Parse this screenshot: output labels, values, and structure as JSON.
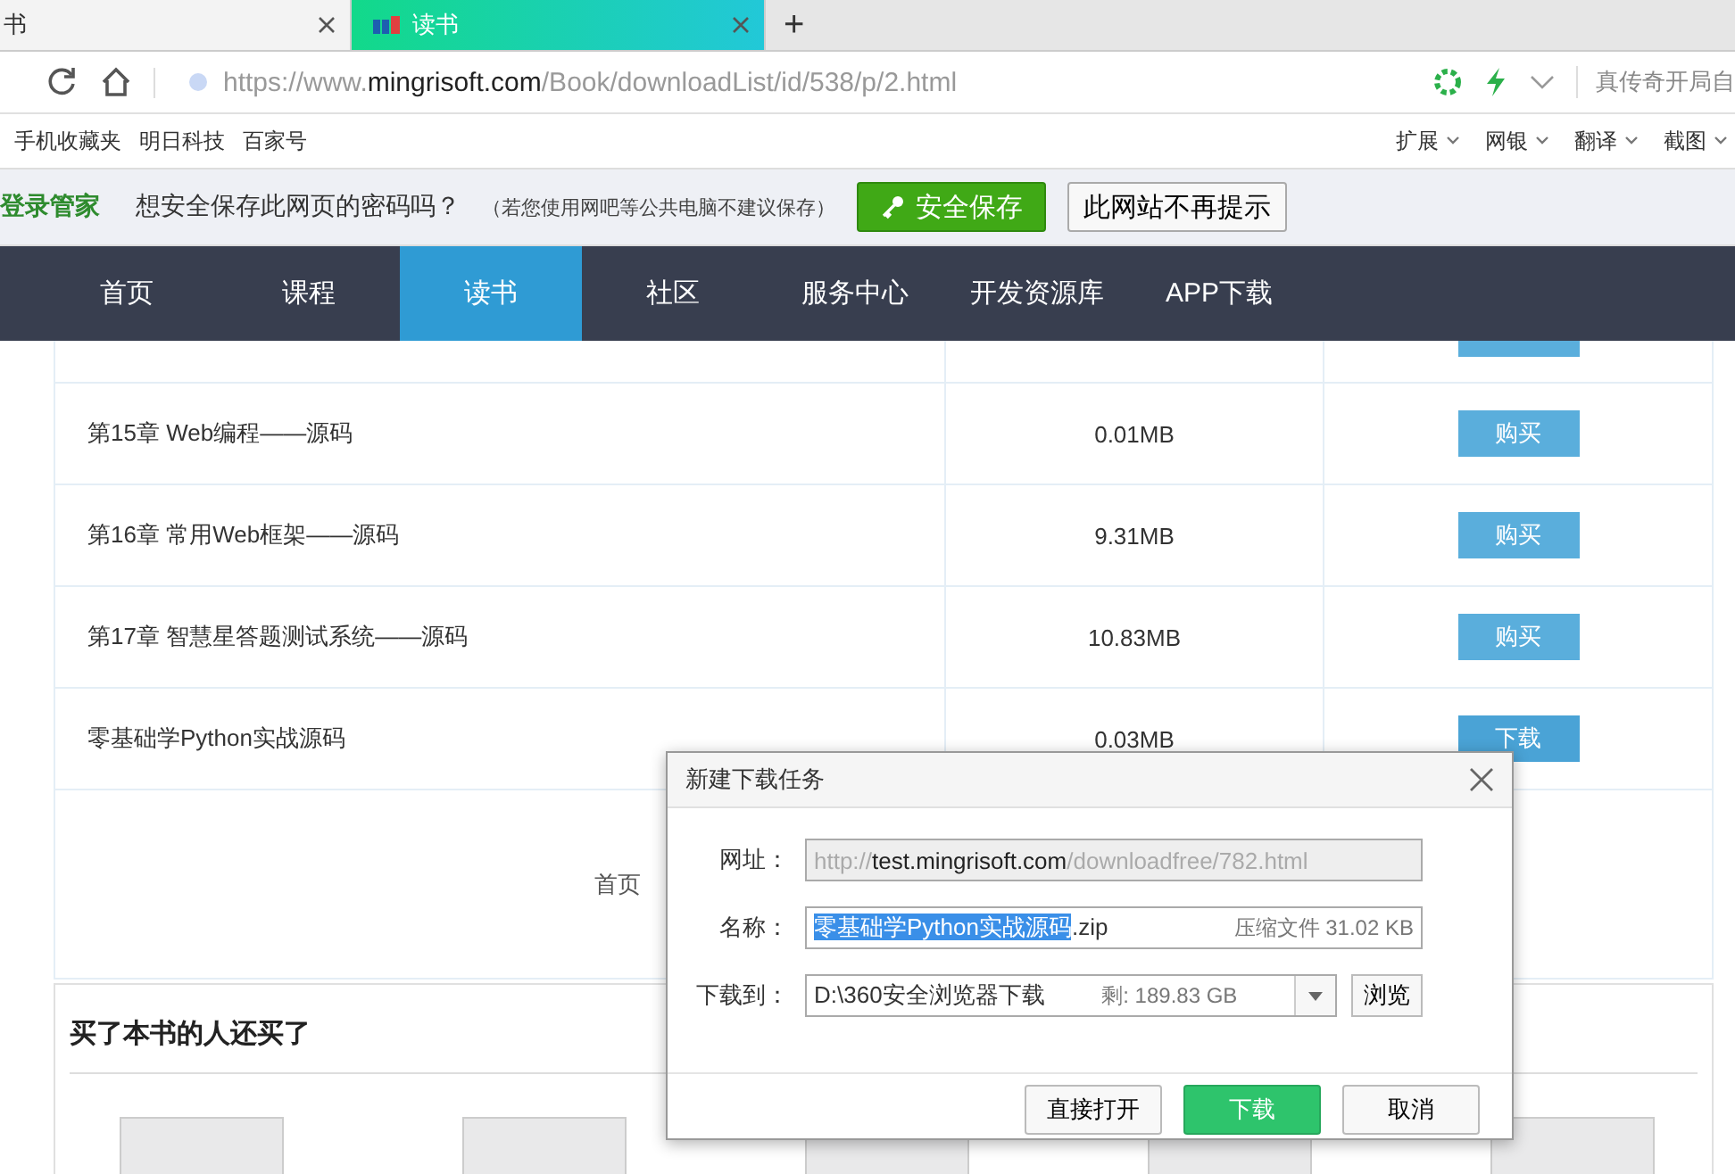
{
  "browser": {
    "tabs": [
      {
        "label": "书",
        "selected": false
      },
      {
        "label": "读书",
        "selected": true
      }
    ],
    "new_tab": "+",
    "address": {
      "scheme": "https://www.",
      "domain": "mingrisoft.com",
      "path": "/Book/downloadList/id/538/p/2.html"
    },
    "search_hint": "真传奇开局自",
    "bookmarks": [
      "手机收藏夹",
      "明日科技",
      "百家号"
    ],
    "tools": [
      "扩展",
      "网银",
      "翻译",
      "截图"
    ],
    "password_bar": {
      "brand": "登录管家",
      "question": "想安全保存此网页的密码吗？",
      "note": "（若您使用网吧等公共电脑不建议保存）",
      "save": "安全保存",
      "never": "此网站不再提示"
    }
  },
  "nav": [
    {
      "label": "首页",
      "selected": false
    },
    {
      "label": "课程",
      "selected": false
    },
    {
      "label": "读书",
      "selected": true
    },
    {
      "label": "社区",
      "selected": false
    },
    {
      "label": "服务中心",
      "selected": false
    },
    {
      "label": "开发资源库",
      "selected": false
    },
    {
      "label": "APP下载",
      "selected": false
    }
  ],
  "downloads": [
    {
      "name": "第15章 Web编程——源码",
      "size": "0.01MB",
      "action": "购买",
      "kind": "buy"
    },
    {
      "name": "第16章 常用Web框架——源码",
      "size": "9.31MB",
      "action": "购买",
      "kind": "buy"
    },
    {
      "name": "第17章 智慧星答题测试系统——源码",
      "size": "10.83MB",
      "action": "购买",
      "kind": "buy"
    },
    {
      "name": "零基础学Python实战源码",
      "size": "0.03MB",
      "action": "下载",
      "kind": "download"
    }
  ],
  "pagination": [
    "首页"
  ],
  "related": {
    "title": "买了本书的人还买了"
  },
  "dialog": {
    "title": "新建下载任务",
    "url_label": "网址：",
    "url_pre": "http://",
    "url_host": "test.mingrisoft.com",
    "url_rest": "/downloadfree/782.html",
    "name_label": "名称：",
    "name_selected": "零基础学Python实战源码",
    "name_ext": ".zip",
    "file_info": "压缩文件 31.02 KB",
    "dest_label": "下载到：",
    "dest": "D:\\360安全浏览器下载",
    "free": "剩: 189.83 GB",
    "browse": "浏览",
    "buttons": [
      {
        "label": "直接打开",
        "kind": "plain"
      },
      {
        "label": "下载",
        "kind": "primary"
      },
      {
        "label": "取消",
        "kind": "plain"
      }
    ]
  }
}
